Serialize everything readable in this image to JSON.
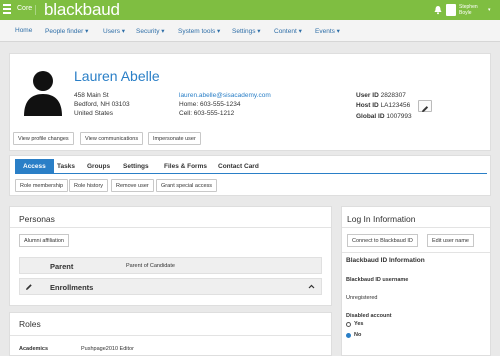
{
  "topbar": {
    "app": "Core",
    "logo": "blackbaud",
    "user_name_line1": "Stephen",
    "user_name_line2": "Boyle"
  },
  "nav": [
    {
      "label": "Home"
    },
    {
      "label": "People finder ▾"
    },
    {
      "label": "Users ▾"
    },
    {
      "label": "Security ▾"
    },
    {
      "label": "System tools ▾"
    },
    {
      "label": "Settings ▾"
    },
    {
      "label": "Content ▾"
    },
    {
      "label": "Events ▾"
    }
  ],
  "profile": {
    "name": "Lauren Abelle",
    "address": [
      "458 Main St",
      "Bedford, NH 03103",
      "United States"
    ],
    "email": "lauren.abelle@sisacademy.com",
    "home": "Home: 603-555-1234",
    "cell": "Cell: 603-555-1212",
    "user_id_label": "User ID",
    "user_id": "2828307",
    "host_id_label": "Host ID",
    "host_id": "LA123456",
    "global_id_label": "Global ID",
    "global_id": "1007993",
    "buttons": [
      "View profile changes",
      "View communications",
      "Impersonate user"
    ]
  },
  "tabs": {
    "items": [
      "Access",
      "Tasks",
      "Groups",
      "Settings",
      "Files & Forms",
      "Contact Card"
    ],
    "active": "Access",
    "sub_buttons": [
      "Role membership",
      "Role history",
      "Remove user",
      "Grant special access"
    ]
  },
  "personas": {
    "title": "Personas",
    "alumni_button": "Alumni affiliation",
    "rows": [
      {
        "label": "Parent",
        "value": "Parent of Candidate"
      },
      {
        "label": "Enrollments",
        "value": ""
      }
    ]
  },
  "roles": {
    "title": "Roles",
    "label": "Academics",
    "value": "Pushpage2010 Editor"
  },
  "login": {
    "title": "Log In Information",
    "connect_button": "Connect to Blackbaud ID",
    "edit_button": "Edit user name",
    "subtitle": "Blackbaud ID Information",
    "username_label": "Blackbaud ID username",
    "username_value": "Unregistered",
    "disabled_label": "Disabled account",
    "opt_yes": "Yes",
    "opt_no": "No",
    "selected": "No"
  },
  "colors": {
    "brand_green": "#7fbe41",
    "link_blue": "#2a7fc7"
  }
}
